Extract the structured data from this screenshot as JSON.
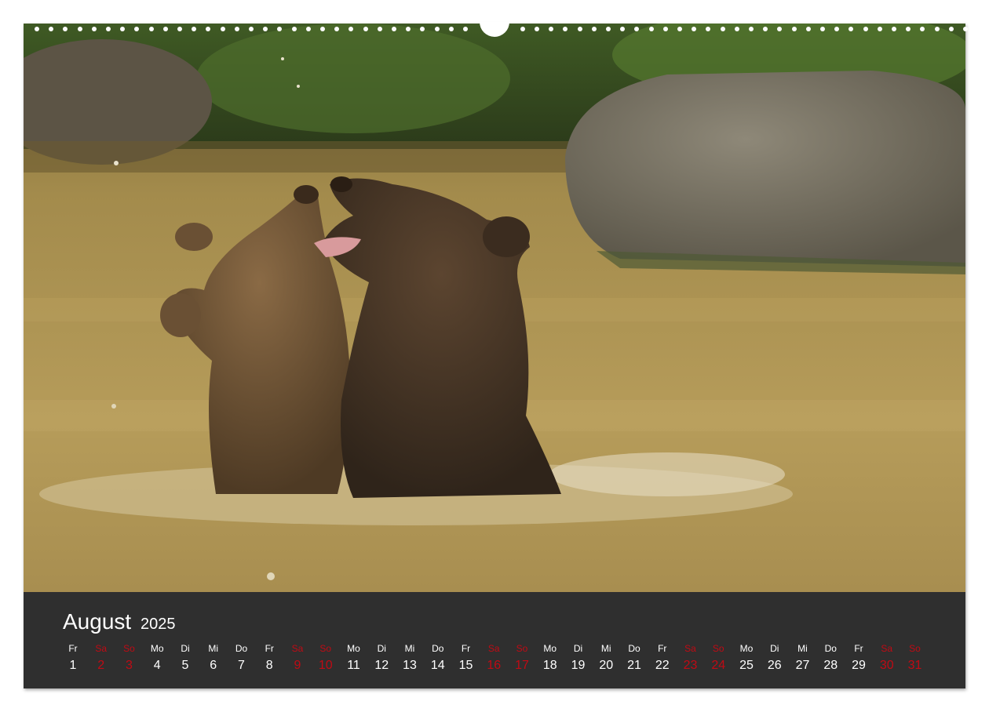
{
  "calendar": {
    "month": "August",
    "year": "2025",
    "weekend_color": "#c00a14",
    "days": [
      {
        "wd": "Fr",
        "num": "1",
        "weekend": false
      },
      {
        "wd": "Sa",
        "num": "2",
        "weekend": true
      },
      {
        "wd": "So",
        "num": "3",
        "weekend": true
      },
      {
        "wd": "Mo",
        "num": "4",
        "weekend": false
      },
      {
        "wd": "Di",
        "num": "5",
        "weekend": false
      },
      {
        "wd": "Mi",
        "num": "6",
        "weekend": false
      },
      {
        "wd": "Do",
        "num": "7",
        "weekend": false
      },
      {
        "wd": "Fr",
        "num": "8",
        "weekend": false
      },
      {
        "wd": "Sa",
        "num": "9",
        "weekend": true
      },
      {
        "wd": "So",
        "num": "10",
        "weekend": true
      },
      {
        "wd": "Mo",
        "num": "11",
        "weekend": false
      },
      {
        "wd": "Di",
        "num": "12",
        "weekend": false
      },
      {
        "wd": "Mi",
        "num": "13",
        "weekend": false
      },
      {
        "wd": "Do",
        "num": "14",
        "weekend": false
      },
      {
        "wd": "Fr",
        "num": "15",
        "weekend": false
      },
      {
        "wd": "Sa",
        "num": "16",
        "weekend": true
      },
      {
        "wd": "So",
        "num": "17",
        "weekend": true
      },
      {
        "wd": "Mo",
        "num": "18",
        "weekend": false
      },
      {
        "wd": "Di",
        "num": "19",
        "weekend": false
      },
      {
        "wd": "Mi",
        "num": "20",
        "weekend": false
      },
      {
        "wd": "Do",
        "num": "21",
        "weekend": false
      },
      {
        "wd": "Fr",
        "num": "22",
        "weekend": false
      },
      {
        "wd": "Sa",
        "num": "23",
        "weekend": true
      },
      {
        "wd": "So",
        "num": "24",
        "weekend": true
      },
      {
        "wd": "Mo",
        "num": "25",
        "weekend": false
      },
      {
        "wd": "Di",
        "num": "26",
        "weekend": false
      },
      {
        "wd": "Mi",
        "num": "27",
        "weekend": false
      },
      {
        "wd": "Do",
        "num": "28",
        "weekend": false
      },
      {
        "wd": "Fr",
        "num": "29",
        "weekend": false
      },
      {
        "wd": "Sa",
        "num": "30",
        "weekend": true
      },
      {
        "wd": "So",
        "num": "31",
        "weekend": true
      }
    ]
  }
}
